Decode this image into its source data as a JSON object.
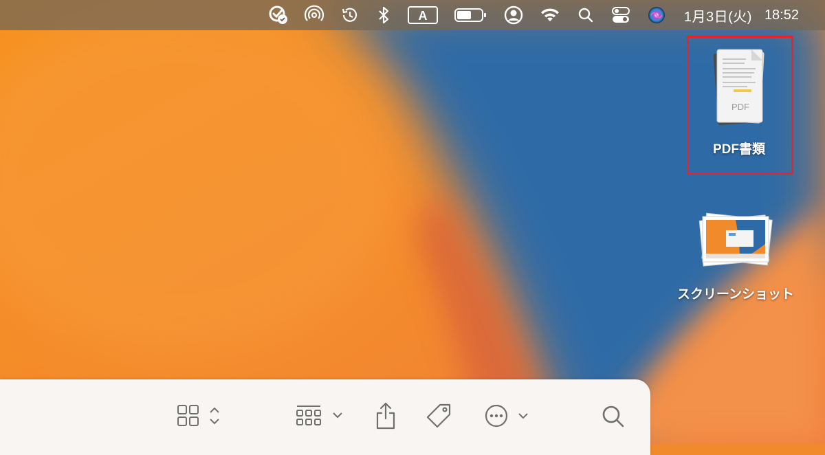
{
  "menubar": {
    "icons": [
      "checklist-icon",
      "airdrop-icon",
      "time-machine-icon",
      "bluetooth-icon",
      "input-source-icon",
      "battery-icon",
      "user-icon",
      "wifi-icon",
      "spotlight-search-icon",
      "control-center-icon",
      "siri-icon"
    ],
    "input_source_label": "A",
    "date": "1月3日(火)",
    "time": "18:52"
  },
  "desktop": {
    "items": [
      {
        "label": "PDF書類",
        "icon": "pdf-document-icon",
        "thumbnail_text": "PDF",
        "selected_highlight": true
      },
      {
        "label": "スクリーンショット",
        "icon": "screenshot-stack-icon"
      }
    ],
    "highlight_color": "#e3262a"
  },
  "toolbar": {
    "buttons": [
      "view-grid-icon",
      "group-by-icon",
      "share-icon",
      "tag-icon",
      "more-actions-icon",
      "search-icon"
    ]
  },
  "colors": {
    "wallpaper_orange": "#f08a2a",
    "wallpaper_blue": "#2f6aa3",
    "toolbar_bg": "#f8f5f2"
  }
}
